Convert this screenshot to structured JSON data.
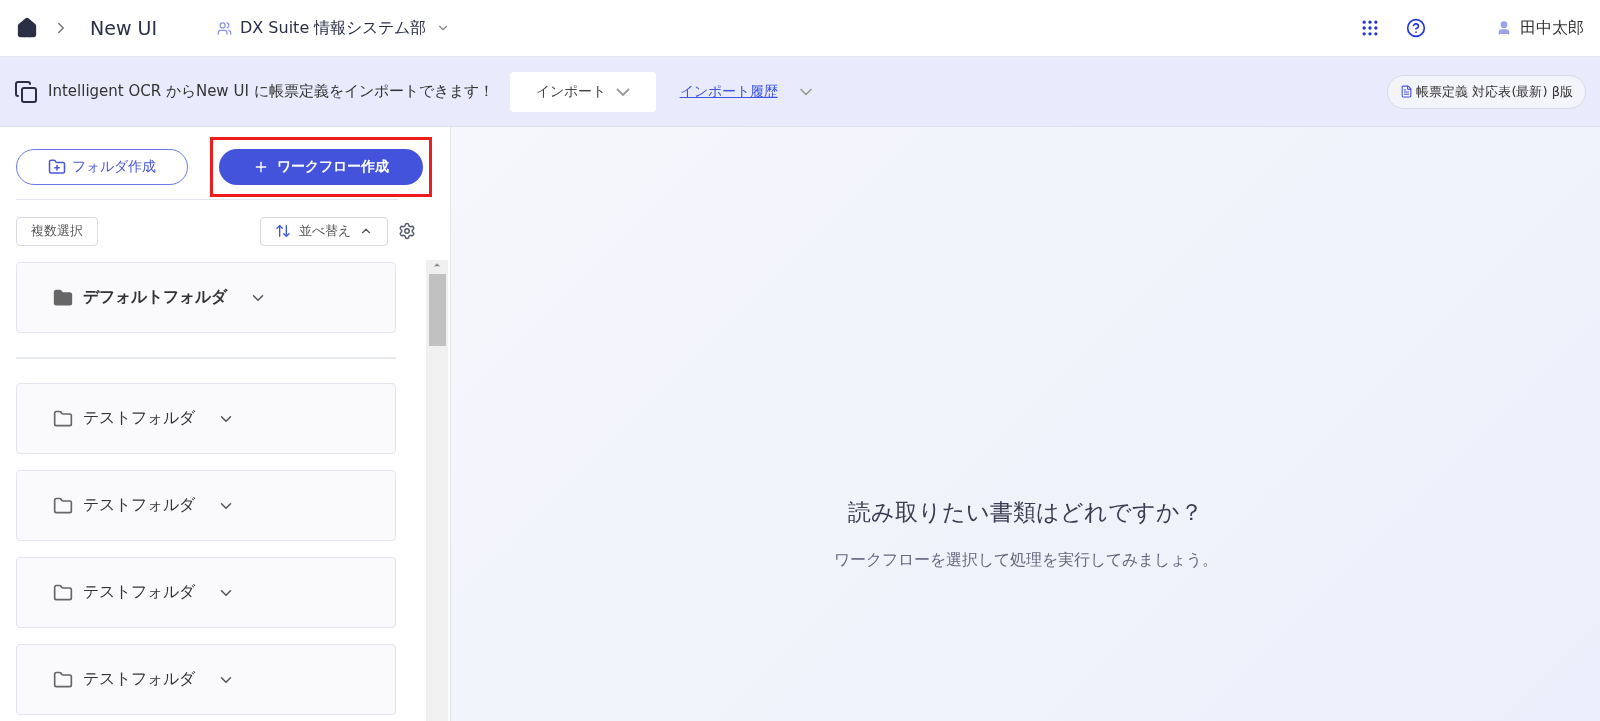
{
  "breadcrumb": {
    "current": "New UI"
  },
  "workspace": {
    "name": "DX Suite 情報システム部"
  },
  "user": {
    "name": "田中太郎"
  },
  "banner": {
    "message": "Intelligent OCR からNew UI に帳票定義をインポートできます！",
    "import_button": "インポート",
    "history_link": "インポート履歴",
    "mapping_button": "帳票定義 対応表(最新) β版"
  },
  "sidebar": {
    "folder_button": "フォルダ作成",
    "workflow_button": "ワークフロー作成",
    "workflow_highlighted": true,
    "multi_select": "複数選択",
    "sort_button": "並べ替え",
    "folders": [
      {
        "kind": "default",
        "name": "デフォルトフォルダ"
      },
      {
        "kind": "regular",
        "name": "テストフォルダ"
      },
      {
        "kind": "regular",
        "name": "テストフォルダ"
      },
      {
        "kind": "regular",
        "name": "テストフォルダ"
      },
      {
        "kind": "regular",
        "name": "テストフォルダ"
      }
    ]
  },
  "main": {
    "title": "読み取りたい書類はどれですか？",
    "subtitle": "ワークフローを選択して処理を実行してみましょう。"
  }
}
